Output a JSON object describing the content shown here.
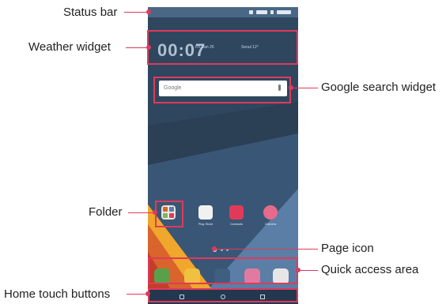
{
  "callouts": {
    "status_bar": "Status bar",
    "weather_widget": "Weather widget",
    "google_search_widget": "Google search widget",
    "folder": "Folder",
    "page_icon": "Page icon",
    "quick_access_area": "Quick access area",
    "home_touch_buttons": "Home touch buttons"
  },
  "phone": {
    "weather": {
      "time": "00:07",
      "date": "Fri, Jan 26",
      "location": "Seoul 12°"
    },
    "search": {
      "logo": "Google"
    },
    "apps": [
      {
        "name": "Folder",
        "label": ""
      },
      {
        "name": "Play Store",
        "label": "Play Store"
      },
      {
        "name": "Contacts",
        "label": "Contacts"
      },
      {
        "name": "Camera",
        "label": "Camera"
      }
    ],
    "quick_access": [
      "Phone",
      "Messages",
      "Camera",
      "Gallery",
      "Chrome"
    ],
    "colors": {
      "accent": "#e03a5a",
      "wallpaper_dark": "#2b3f55",
      "wallpaper_orange": "#d9642c",
      "wallpaper_blue": "#5a7ea6"
    }
  }
}
